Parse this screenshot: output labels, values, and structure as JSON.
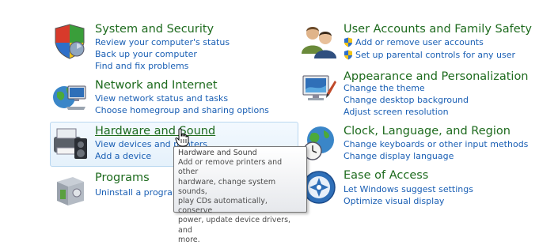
{
  "categories": {
    "system_security": {
      "title": "System and Security",
      "links": [
        "Review your computer's status",
        "Back up your computer",
        "Find and fix problems"
      ],
      "icon": "shield-icon"
    },
    "network_internet": {
      "title": "Network and Internet",
      "links": [
        "View network status and tasks",
        "Choose homegroup and sharing options"
      ],
      "icon": "network-globe-icon"
    },
    "hardware_sound": {
      "title": "Hardware and Sound",
      "links": [
        "View devices and printers",
        "Add a device"
      ],
      "icon": "printer-icon"
    },
    "programs": {
      "title": "Programs",
      "links": [
        "Uninstall a program"
      ],
      "icon": "programs-box-icon"
    },
    "user_accounts": {
      "title": "User Accounts and Family Safety",
      "links": [
        "Add or remove user accounts",
        "Set up parental controls for any user"
      ],
      "icon": "users-icon",
      "link_icon": "uac-shield-icon"
    },
    "appearance": {
      "title": "Appearance and Personalization",
      "links": [
        "Change the theme",
        "Change desktop background",
        "Adjust screen resolution"
      ],
      "icon": "monitor-paint-icon"
    },
    "clock_region": {
      "title": "Clock, Language, and Region",
      "links": [
        "Change keyboards or other input methods",
        "Change display language"
      ],
      "icon": "clock-globe-icon"
    },
    "ease_access": {
      "title": "Ease of Access",
      "links": [
        "Let Windows suggest settings",
        "Optimize visual display"
      ],
      "icon": "ease-of-access-icon"
    }
  },
  "tooltip": {
    "title": "Hardware and Sound",
    "lines": [
      "Add or remove printers and other",
      "hardware, change system sounds,",
      "play CDs automatically, conserve",
      "power, update device drivers, and",
      "more."
    ]
  },
  "colors": {
    "title_green": "#1e6b1e",
    "link_blue": "#1a5fb4",
    "hover_bg": "#e5f1fb",
    "hover_border": "#b9d7f0"
  }
}
